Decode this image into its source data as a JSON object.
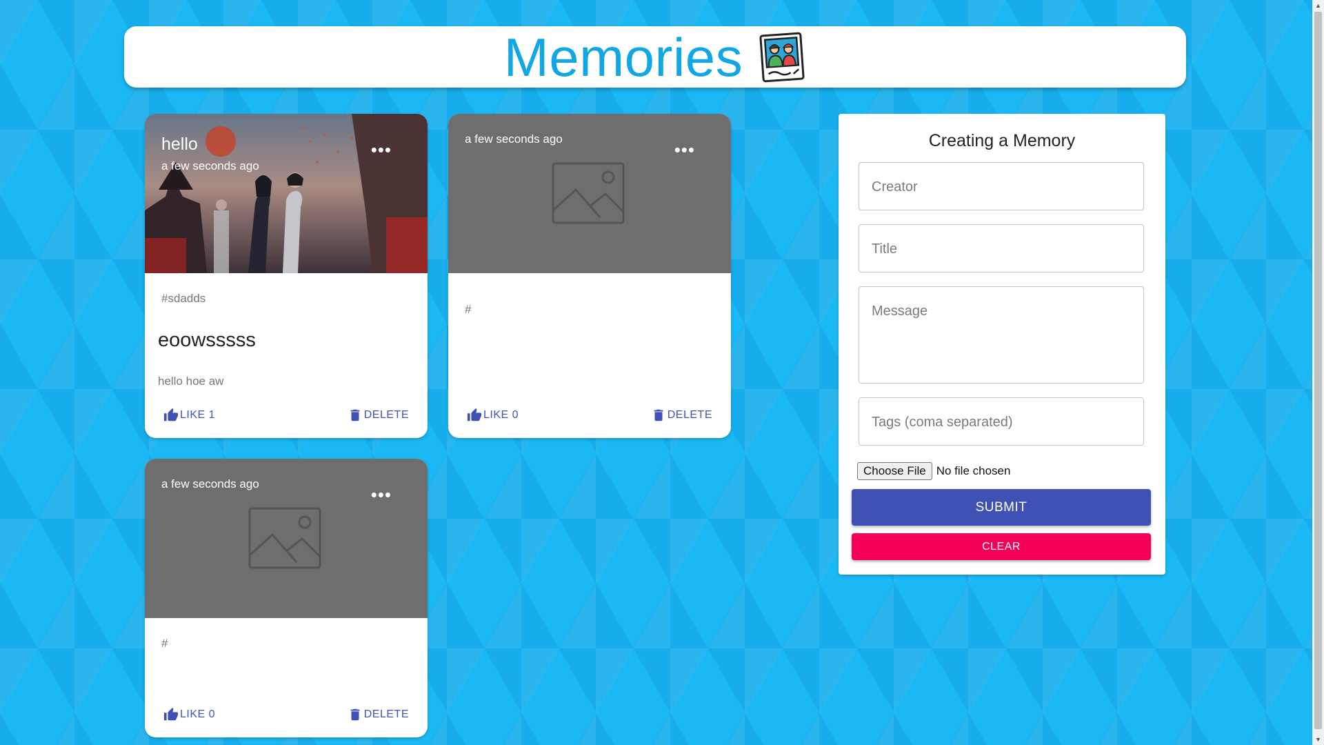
{
  "app": {
    "title": "Memories",
    "accent_color": "#11a7e7",
    "logo_icon": "photo-card-icon"
  },
  "posts": [
    {
      "creator": "hello",
      "time": "a few seconds ago",
      "tags": "#sdadds",
      "title": "eoowsssss",
      "message": "hello hoe aw",
      "like_label": "LIKE 1",
      "delete_label": "DELETE",
      "more_icon": "more-horiz-icon",
      "image": "anime-couple-photo"
    },
    {
      "creator": "",
      "time": "a few seconds ago",
      "tags": "#",
      "title": "",
      "message": "",
      "like_label": "LIKE 0",
      "delete_label": "DELETE",
      "more_icon": "more-horiz-icon",
      "image": "image-placeholder-icon"
    },
    {
      "creator": "",
      "time": "a few seconds ago",
      "tags": "#",
      "title": "",
      "message": "",
      "like_label": "LIKE 0",
      "delete_label": "DELETE",
      "more_icon": "more-horiz-icon",
      "image": "image-placeholder-icon"
    }
  ],
  "form": {
    "heading": "Creating a Memory",
    "creator_placeholder": "Creator",
    "title_placeholder": "Title",
    "message_placeholder": "Message",
    "tags_placeholder": "Tags (coma separated)",
    "file_button": "Choose File",
    "file_status": "No file chosen",
    "submit_label": "SUBMIT",
    "clear_label": "CLEAR",
    "submit_color": "#3f51b5",
    "clear_color": "#f50057"
  },
  "colors": {
    "background": "#1ab8f5",
    "action_text": "#3f51b5"
  }
}
